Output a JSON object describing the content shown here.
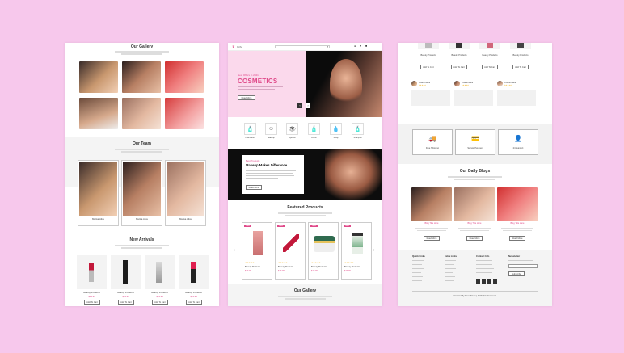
{
  "panel1": {
    "gallery_title": "Our Gallery",
    "team_title": "Our Team",
    "team_members": [
      {
        "name": "Marisa Alice"
      },
      {
        "name": "Marisa Alice"
      },
      {
        "name": "Marisa Alice"
      }
    ],
    "arrivals_title": "New Arrivals",
    "arrivals": [
      {
        "name": "Beauty Products",
        "price": "$49.99",
        "button": "Add To Cart"
      },
      {
        "name": "Beauty Products",
        "price": "$49.99",
        "button": "Add To Cart"
      },
      {
        "name": "Beauty Products",
        "price": "$49.99",
        "button": "Add To Cart"
      },
      {
        "name": "Beauty Products",
        "price": "$49.99",
        "button": "Add To Cart"
      }
    ]
  },
  "panel2": {
    "brand": "Girly",
    "hero_kicker": "New Offers In 2021",
    "hero_title": "COSMETICS",
    "hero_button": "Read More",
    "categories": [
      {
        "label": "Foundation",
        "icon": "foundation-icon",
        "glyph": "🧴"
      },
      {
        "label": "Makeup",
        "icon": "makeup-face-icon",
        "glyph": "☺"
      },
      {
        "label": "Eyelash",
        "icon": "eyelash-icon",
        "glyph": "👁"
      },
      {
        "label": "Lotion",
        "icon": "lotion-icon",
        "glyph": "🧴"
      },
      {
        "label": "Spray",
        "icon": "spray-icon",
        "glyph": "💧"
      },
      {
        "label": "Shampoo",
        "icon": "shampoo-icon",
        "glyph": "🧴"
      }
    ],
    "promo_kicker": "Best Products",
    "promo_title": "Makeup Makes Difference",
    "promo_button": "Read More",
    "featured_title": "Featured Products",
    "featured": [
      {
        "name": "Beauty Products",
        "price": "$49.99",
        "tag": "New"
      },
      {
        "name": "Beauty Products",
        "price": "$49.99",
        "tag": "New"
      },
      {
        "name": "Beauty Products",
        "price": "$49.99",
        "tag": "New"
      },
      {
        "name": "Beauty Products",
        "price": "$49.99",
        "tag": "New"
      }
    ],
    "gallery_title": "Our Gallery"
  },
  "panel3": {
    "top_products": [
      {
        "name": "Beauty Products",
        "button": "Add To Cart"
      },
      {
        "name": "Beauty Products",
        "button": "Add To Cart"
      },
      {
        "name": "Beauty Products",
        "button": "Add To Cart"
      },
      {
        "name": "Beauty Products",
        "button": "Add To Cart"
      }
    ],
    "testimonials": [
      {
        "name": "Crisha Mitra"
      },
      {
        "name": "Crisha Mitra"
      },
      {
        "name": "Crisha Mitra"
      }
    ],
    "features": [
      {
        "label": "Free Shipping",
        "icon": "truck-icon",
        "glyph": "🚚"
      },
      {
        "label": "Secure Payment",
        "icon": "secure-payment-icon",
        "glyph": "💳"
      },
      {
        "label": "24 Support",
        "icon": "support-icon",
        "glyph": "👤"
      }
    ],
    "blogs_title": "Our Daily Blogs",
    "blogs": [
      {
        "title": "Blog Title Here",
        "button": "Read More"
      },
      {
        "title": "Blog Title Here",
        "button": "Read More"
      },
      {
        "title": "Blog Title Here",
        "button": "Read More"
      }
    ],
    "footer": {
      "col1": "Quick Links",
      "col2": "Extra Links",
      "col3": "Contact Info",
      "col4": "Newsletter",
      "subscribe": "Subscribe",
      "copyright": "Created By SomeName | All Rights Reserved"
    }
  },
  "colors": {
    "accent": "#e04b8a",
    "background": "#f7c8ec"
  }
}
